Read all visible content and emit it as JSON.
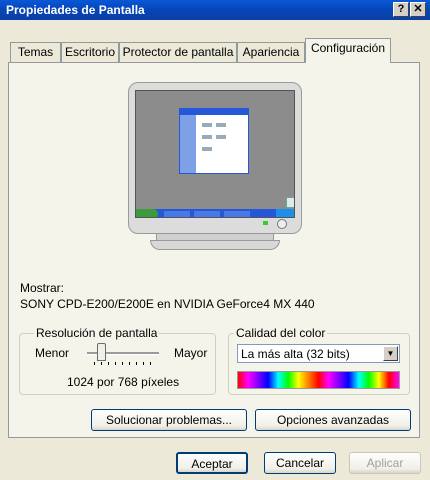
{
  "window": {
    "title": "Propiedades de Pantalla",
    "help_label": "?",
    "close_label": "✕"
  },
  "tabs": [
    {
      "label": "Temas",
      "active": false
    },
    {
      "label": "Escritorio",
      "active": false
    },
    {
      "label": "Protector de pantalla",
      "active": false
    },
    {
      "label": "Apariencia",
      "active": false
    },
    {
      "label": "Configuración",
      "active": true
    }
  ],
  "display": {
    "label": "Mostrar:",
    "device": "SONY CPD-E200/E200E en NVIDIA GeForce4 MX 440"
  },
  "resolution": {
    "group_label": "Resolución de pantalla",
    "min_label": "Menor",
    "max_label": "Mayor",
    "value_text": "1024 por 768 píxeles",
    "slider_level": 0.2
  },
  "color_quality": {
    "group_label": "Calidad del color",
    "selected": "La más alta (32 bits)"
  },
  "panel_buttons": {
    "troubleshoot": "Solucionar problemas...",
    "advanced": "Opciones avanzadas"
  },
  "dialog_buttons": {
    "ok": "Aceptar",
    "cancel": "Cancelar",
    "apply": "Aplicar"
  },
  "colors": {
    "titlebar": "#0a58d8",
    "desktop": "#8c8c8c",
    "taskbar": "#2458d8",
    "start_button": "#3c9c3c"
  }
}
